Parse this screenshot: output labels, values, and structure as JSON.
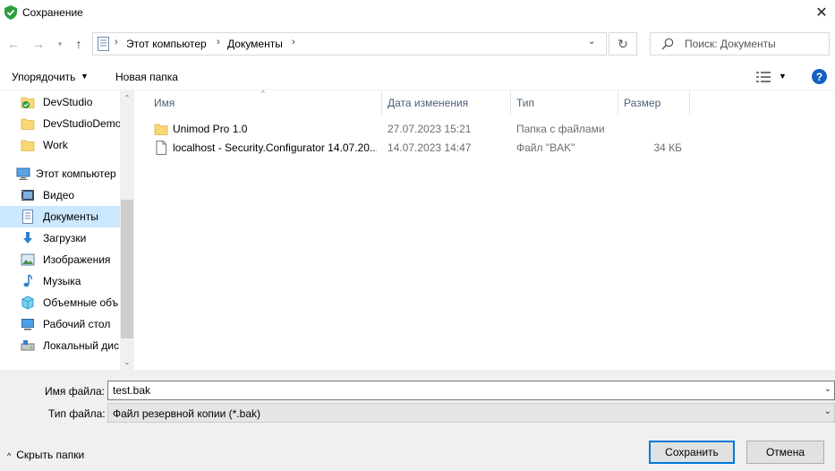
{
  "window": {
    "title": "Сохранение",
    "close_glyph": "✕"
  },
  "nav": {
    "back_glyph": "←",
    "forward_glyph": "→",
    "recent_glyph": "▾",
    "up_glyph": "↑",
    "address": [
      "Этот компьютер",
      "Документы"
    ],
    "address_sep": "›",
    "address_dropdown": "⌄",
    "refresh_glyph": "↻",
    "search_placeholder": "Поиск: Документы"
  },
  "toolbar": {
    "organize_label": "Упорядочить",
    "organize_chevron": "▼",
    "new_folder_label": "Новая папка",
    "view_chevron": "▼",
    "help_label": "?"
  },
  "sidebar": {
    "items": [
      {
        "label": "DevStudio",
        "icon": "devstudio-folder-icon",
        "level": "child"
      },
      {
        "label": "DevStudioDemo",
        "icon": "folder-icon",
        "level": "child"
      },
      {
        "label": "Work",
        "icon": "folder-icon",
        "level": "child"
      },
      {
        "label": "Этот компьютер",
        "icon": "computer-icon",
        "level": "top"
      },
      {
        "label": "Видео",
        "icon": "video-icon",
        "level": "child"
      },
      {
        "label": "Документы",
        "icon": "documents-icon",
        "level": "child",
        "selected": true
      },
      {
        "label": "Загрузки",
        "icon": "downloads-icon",
        "level": "child"
      },
      {
        "label": "Изображения",
        "icon": "pictures-icon",
        "level": "child"
      },
      {
        "label": "Музыка",
        "icon": "music-icon",
        "level": "child"
      },
      {
        "label": "Объемные объ",
        "icon": "3d-objects-icon",
        "level": "child"
      },
      {
        "label": "Рабочий стол",
        "icon": "desktop-icon",
        "level": "child"
      },
      {
        "label": "Локальный дис",
        "icon": "local-disk-icon",
        "level": "child"
      }
    ],
    "scroll_up": "⌃",
    "scroll_down": "⌄"
  },
  "columns": {
    "name": "Имя",
    "date": "Дата изменения",
    "type": "Тип",
    "size": "Размер",
    "sort_indicator": "^"
  },
  "files": [
    {
      "name": "Unimod Pro 1.0",
      "date": "27.07.2023 15:21",
      "type": "Папка с файлами",
      "size": "",
      "icon": "folder-icon"
    },
    {
      "name": "localhost - Security.Configurator 14.07.20...",
      "date": "14.07.2023 14:47",
      "type": "Файл \"BAK\"",
      "size": "34 КБ",
      "icon": "file-icon"
    }
  ],
  "form": {
    "filename_label": "Имя файла:",
    "filename_value": "test.bak",
    "filetype_label": "Тип файла:",
    "filetype_value": "Файл резервной копии (*.bak)",
    "dropdown_glyph": "⌄"
  },
  "footer": {
    "hide_folders_chevron": "^",
    "hide_folders_label": "Скрыть папки",
    "save_label": "Сохранить",
    "cancel_label": "Отмена"
  },
  "colors": {
    "selection": "#cce8ff",
    "accent": "#0078d7",
    "help_blue": "#1660c0",
    "folder_yellow": "#f8d775"
  }
}
